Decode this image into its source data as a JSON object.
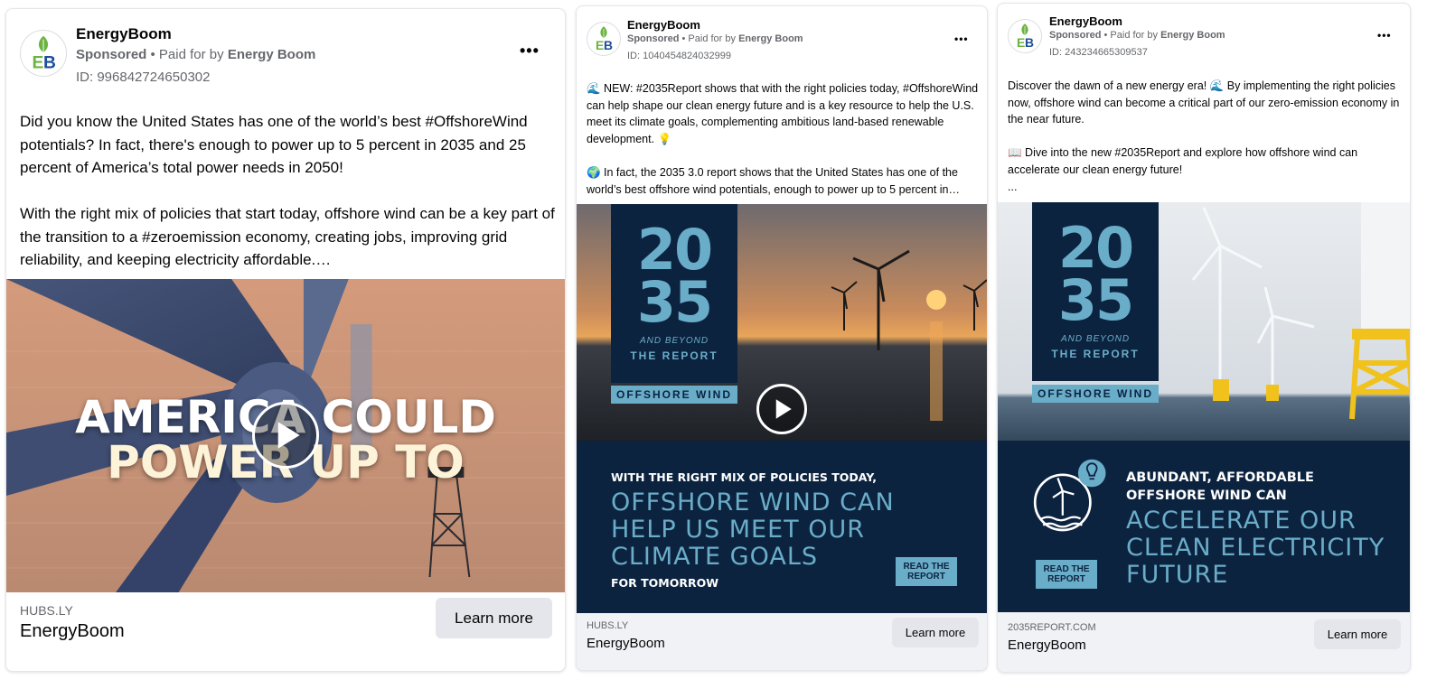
{
  "ads": [
    {
      "advertiser": "EnergyBoom",
      "sponsored_label": "Sponsored",
      "paid_prefix": " • Paid for by ",
      "paid_by": "Energy Boom",
      "ad_id": "ID: 996842724650302",
      "body_text": "Did you know the United States has one of the world’s best #OffshoreWind potentials? In fact, there's enough to power up to 5 percent in 2035 and 25 percent of America’s total power needs in 2050!\n\nWith the right mix of policies that start today, offshore wind can be a key part of the transition to a #zeroemission economy, creating jobs, improving grid reliability, and keeping electricity affordable.…",
      "video_overlay_line1": "AMERICA COULD",
      "video_overlay_line2": "POWER UP TO",
      "domain": "HUBS.LY",
      "footer_title": "EnergyBoom",
      "cta_label": "Learn more"
    },
    {
      "advertiser": "EnergyBoom",
      "sponsored_label": "Sponsored",
      "paid_prefix": " • Paid for by ",
      "paid_by": "Energy Boom",
      "ad_id": "ID: 1040454824032999",
      "body_text": "🌊 NEW: #2035Report shows that with the right policies today, #OffshoreWind can help shape our clean energy future and is a key resource to help the U.S. meet its climate goals, complementing ambitious land-based renewable development. 💡\n\n🌍 In fact, the 2035 3.0 report shows that the United States has one of the world’s best offshore wind potentials, enough to power up to 5 percent in…",
      "report_num_top": "20",
      "report_num_bottom": "35",
      "report_and_beyond": "AND BEYOND",
      "report_the_report": "THE REPORT",
      "report_offshore": "OFFSHORE WIND",
      "band_small": "WITH THE RIGHT MIX OF POLICIES TODAY,",
      "band_big": "OFFSHORE WIND CAN\nHELP US MEET OUR\nCLIMATE GOALS",
      "band_small_bottom": "FOR TOMORROW",
      "read_report": "READ THE REPORT",
      "domain": "HUBS.LY",
      "footer_title": "EnergyBoom",
      "cta_label": "Learn more"
    },
    {
      "advertiser": "EnergyBoom",
      "sponsored_label": "Sponsored",
      "paid_prefix": " • Paid for by ",
      "paid_by": "Energy Boom",
      "ad_id": "ID: 243234665309537",
      "body_text": "Discover the dawn of a new energy era! 🌊 By implementing the right policies now, offshore wind can become a critical part of our zero-emission economy in the near future.\n\n📖 Dive into the new #2035Report and explore how offshore wind can accelerate our clean energy future!\n...",
      "report_num_top": "20",
      "report_num_bottom": "35",
      "report_and_beyond": "AND BEYOND",
      "report_the_report": "THE REPORT",
      "report_offshore": "OFFSHORE WIND",
      "band_small": "ABUNDANT, AFFORDABLE\nOFFSHORE WIND CAN",
      "band_big": "ACCELERATE OUR\nCLEAN ELECTRICITY\nFUTURE",
      "read_report": "READ THE REPORT",
      "domain": "2035REPORT.COM",
      "footer_title": "EnergyBoom",
      "cta_label": "Learn more"
    }
  ],
  "logo_text": "EB",
  "colors": {
    "report_navy": "#0c2340",
    "report_blue": "#6aadc8",
    "logo_green": "#6cb33f",
    "logo_blue": "#1c4e9a"
  }
}
